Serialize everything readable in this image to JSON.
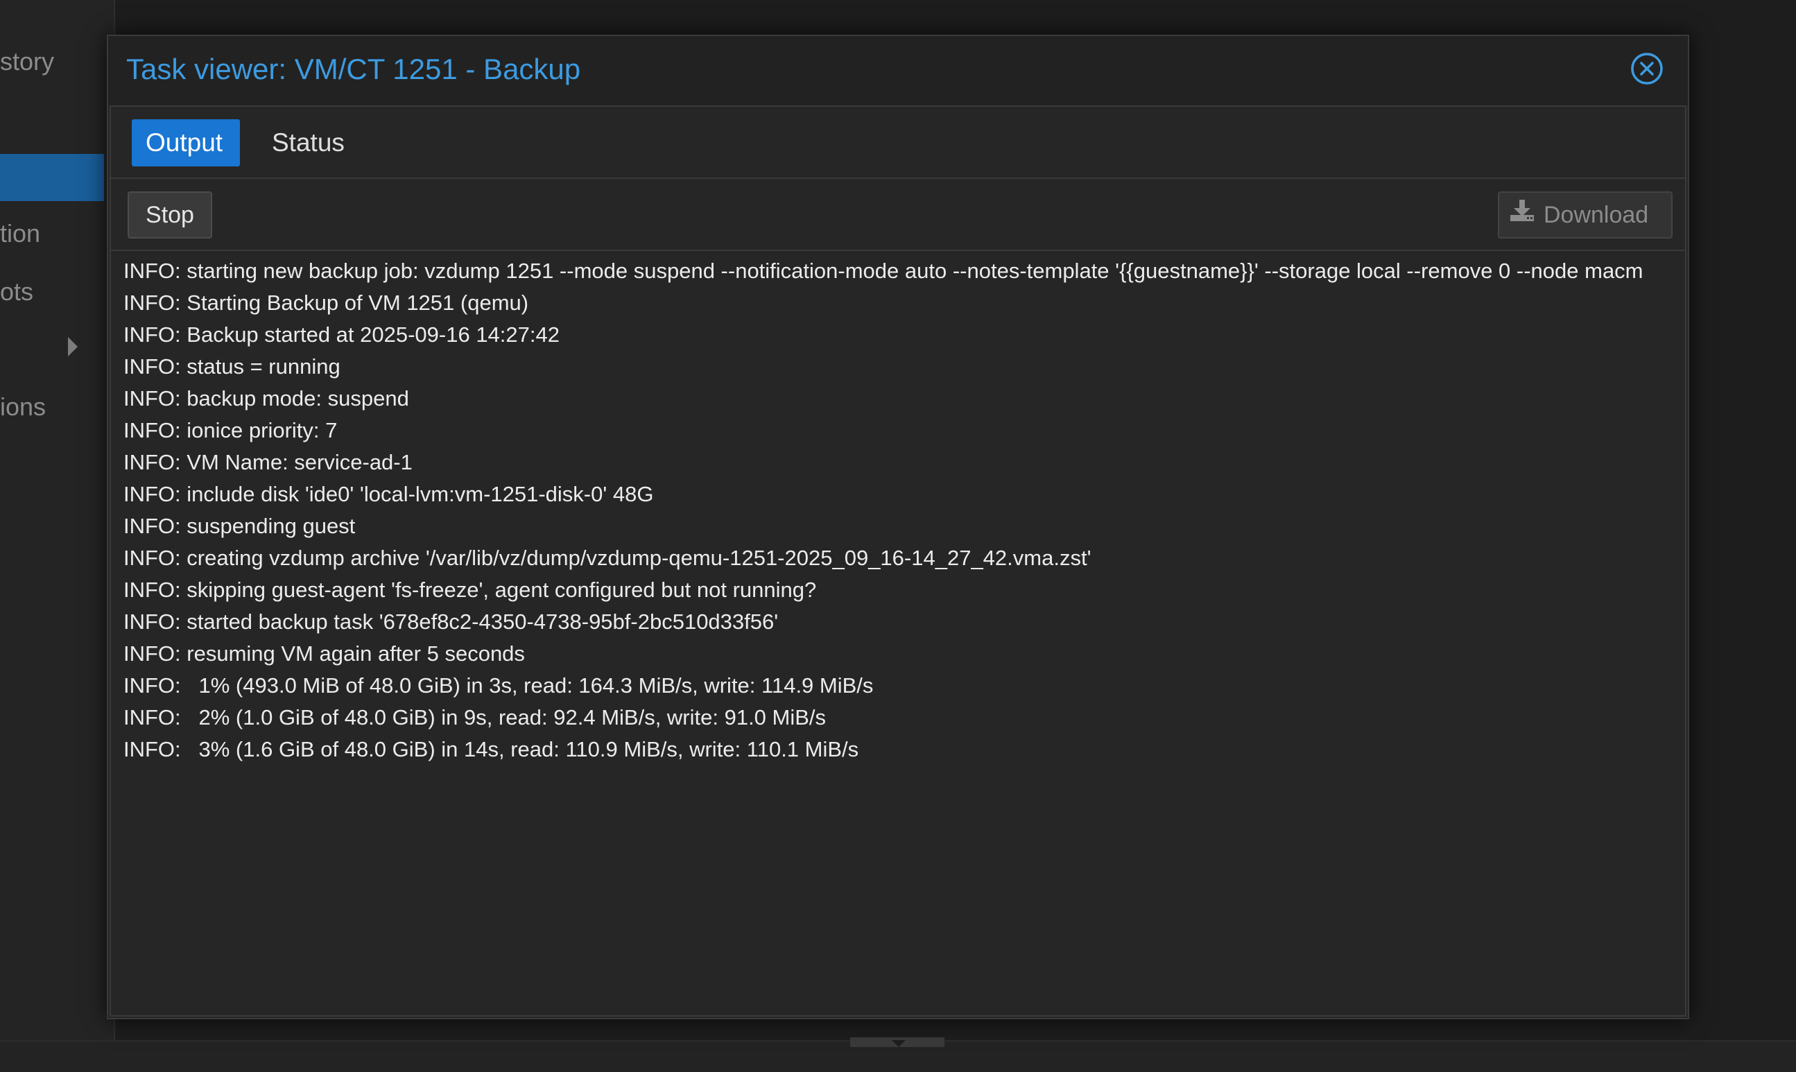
{
  "background": {
    "left_nav_items": [
      "story",
      "tion",
      "ots",
      "ions"
    ]
  },
  "dialog": {
    "title": "Task viewer: VM/CT 1251 - Backup",
    "close_icon": "close-circle-icon",
    "tabs": [
      {
        "label": "Output",
        "active": true
      },
      {
        "label": "Status",
        "active": false
      }
    ],
    "toolbar": {
      "stop_label": "Stop",
      "download_label": "Download",
      "download_icon": "download-icon",
      "download_enabled": false
    },
    "log_lines": [
      "INFO: starting new backup job: vzdump 1251 --mode suspend --notification-mode auto --notes-template '{{guestname}}' --storage local --remove 0 --node macm",
      "INFO: Starting Backup of VM 1251 (qemu)",
      "INFO: Backup started at 2025-09-16 14:27:42",
      "INFO: status = running",
      "INFO: backup mode: suspend",
      "INFO: ionice priority: 7",
      "INFO: VM Name: service-ad-1",
      "INFO: include disk 'ide0' 'local-lvm:vm-1251-disk-0' 48G",
      "INFO: suspending guest",
      "INFO: creating vzdump archive '/var/lib/vz/dump/vzdump-qemu-1251-2025_09_16-14_27_42.vma.zst'",
      "INFO: skipping guest-agent 'fs-freeze', agent configured but not running?",
      "INFO: started backup task '678ef8c2-4350-4738-95bf-2bc510d33f56'",
      "INFO: resuming VM again after 5 seconds",
      "INFO:   1% (493.0 MiB of 48.0 GiB) in 3s, read: 164.3 MiB/s, write: 114.9 MiB/s",
      "INFO:   2% (1.0 GiB of 48.0 GiB) in 9s, read: 92.4 MiB/s, write: 91.0 MiB/s",
      "INFO:   3% (1.6 GiB of 48.0 GiB) in 14s, read: 110.9 MiB/s, write: 110.1 MiB/s"
    ]
  },
  "colors": {
    "title": "#3d9be0",
    "active_tab": "#1976d2",
    "selected_nav": "#1a5e9a"
  }
}
